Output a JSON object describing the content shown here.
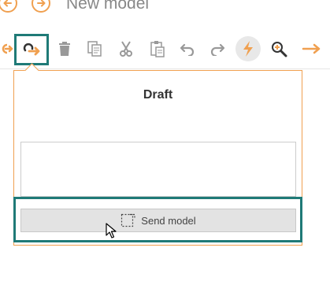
{
  "header": {
    "title": "New model",
    "back_icon": "arrow-left-circle-icon",
    "forward_icon": "arrow-right-circle-icon"
  },
  "toolbar": {
    "items": [
      {
        "name": "undo-back-icon",
        "interactable": true
      },
      {
        "name": "send-forward-icon",
        "interactable": true
      },
      {
        "name": "trash-icon",
        "interactable": true
      },
      {
        "name": "copy-icon",
        "interactable": true
      },
      {
        "name": "cut-icon",
        "interactable": true
      },
      {
        "name": "paste-icon",
        "interactable": true
      },
      {
        "name": "undo-icon",
        "interactable": true
      },
      {
        "name": "redo-icon",
        "interactable": true
      },
      {
        "name": "lightning-icon",
        "interactable": true
      },
      {
        "name": "zoom-in-icon",
        "interactable": true
      },
      {
        "name": "arrow-right-icon",
        "interactable": true
      }
    ]
  },
  "panel": {
    "title": "Draft",
    "textarea_value": "",
    "send_button_label": "Send model"
  },
  "colors": {
    "accent": "#f0a050",
    "highlight": "#1f7a77"
  }
}
